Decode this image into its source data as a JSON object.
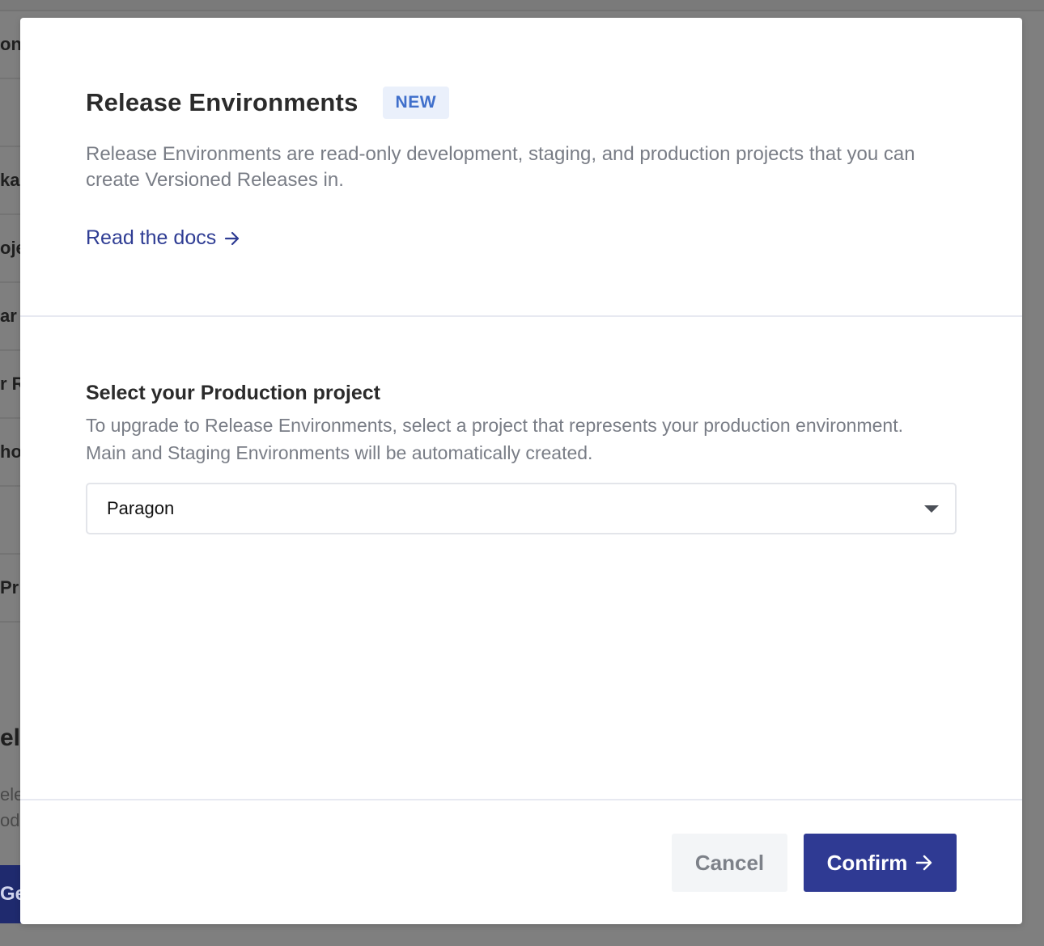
{
  "background": {
    "row_fragments": [
      "on",
      "",
      "ka",
      "oje",
      "ar",
      "r R",
      "ho",
      "",
      "Pr"
    ],
    "heading_fragment": "el",
    "text_fragments": [
      "ele",
      "od"
    ],
    "button_fragment": "Ge"
  },
  "modal": {
    "title": "Release Environments",
    "badge": "NEW",
    "description": "Release Environments are read-only development, staging, and production projects that you can create Versioned Releases in.",
    "docs_link": "Read the docs",
    "section_title": "Select your Production project",
    "section_description": "To upgrade to Release Environments, select a project that represents your production environment. Main and Staging Environments will be automatically created.",
    "select": {
      "value": "Paragon"
    },
    "buttons": {
      "cancel": "Cancel",
      "confirm": "Confirm"
    }
  },
  "colors": {
    "accent": "#2f3a93",
    "link": "#2f3d94",
    "badge_bg": "#eaf0fb",
    "badge_text": "#3f6fcb",
    "overlay": "#7f7f7f"
  },
  "icons": {
    "docs_arrow": "arrow-right-icon",
    "confirm_arrow": "arrow-right-icon",
    "select_caret": "caret-down-icon"
  }
}
